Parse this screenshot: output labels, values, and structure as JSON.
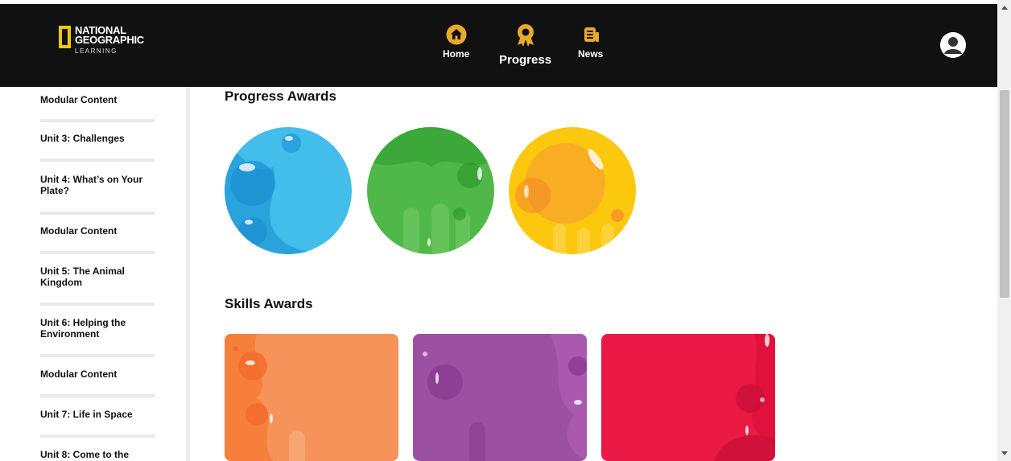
{
  "logo": {
    "line1": "NATIONAL",
    "line2": "GEOGRAPHIC",
    "sub": "LEARNING"
  },
  "nav": [
    {
      "label": "Home",
      "icon": "home-icon"
    },
    {
      "label": "Progress",
      "icon": "award-ribbon-icon"
    },
    {
      "label": "News",
      "icon": "news-icon"
    }
  ],
  "profile": {
    "icon": "user-avatar-icon"
  },
  "sidebar": {
    "items": [
      "Modular Content",
      "Unit 3: Challenges",
      "Unit 4: What’s on Your Plate?",
      "Modular Content",
      "Unit 5: The Animal Kingdom",
      "Unit 6: Helping the Environment",
      "Modular Content",
      "Unit 7: Life in Space",
      "Unit 8: Come to the"
    ]
  },
  "sections": {
    "progress_awards": "Progress Awards",
    "skills_awards": "Skills Awards"
  },
  "colors": {
    "topbar": "#111111",
    "accent_gold": "#e9a92a",
    "blue": "#43bde9",
    "green": "#50b848",
    "yellow": "#fcc80e",
    "orange": "#f5935a",
    "purple": "#9b50a1",
    "red": "#ea1a45"
  }
}
